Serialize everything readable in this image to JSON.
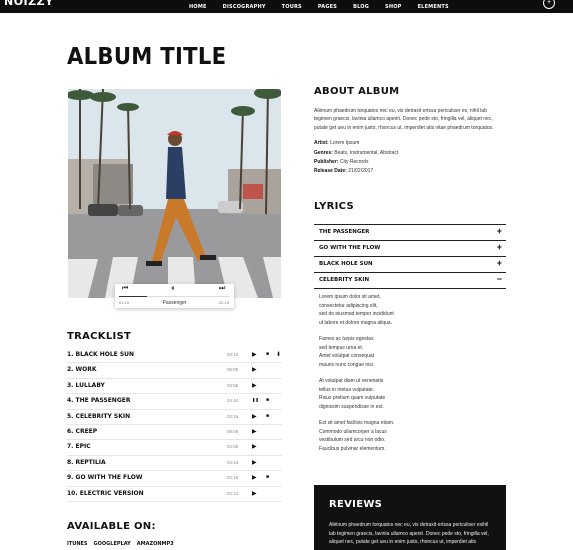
{
  "header": {
    "logo": "NOIZZY",
    "nav": [
      "HOME",
      "DISCOGRAPHY",
      "TOURS",
      "PAGES",
      "BLOG",
      "SHOP",
      "ELEMENTS"
    ],
    "menu_icon": "plus-circle-icon"
  },
  "album": {
    "title": "ALBUM TITLE"
  },
  "player": {
    "current_time": "01:15",
    "track_name": "Passenger",
    "total_time": "02:15",
    "progress": 0.25,
    "prev_icon": "skip-back-icon",
    "pause_icon": "pause-icon",
    "next_icon": "skip-forward-icon"
  },
  "tracklist": {
    "title": "TRACKLIST",
    "tracks": [
      {
        "name": "1. BLACK HOLE SUN",
        "duration": "02:16",
        "icons": [
          "play",
          "video",
          "download"
        ]
      },
      {
        "name": "2. WORK",
        "duration": "05:05",
        "icons": [
          "play"
        ]
      },
      {
        "name": "3. LULLABY",
        "duration": "02:55",
        "icons": [
          "play"
        ]
      },
      {
        "name": "4. THE PASSENGER",
        "duration": "04:44",
        "icons": [
          "pause",
          "video"
        ]
      },
      {
        "name": "5. CELEBRITY SKIN",
        "duration": "02:16",
        "icons": [
          "play",
          "video"
        ]
      },
      {
        "name": "6. CREEP",
        "duration": "05:05",
        "icons": [
          "play"
        ]
      },
      {
        "name": "7. EPIC",
        "duration": "02:55",
        "icons": [
          "play"
        ]
      },
      {
        "name": "8. REPTILIA",
        "duration": "04:44",
        "icons": [
          "play"
        ]
      },
      {
        "name": "9. GO WITH THE FLOW",
        "duration": "02:16",
        "icons": [
          "play",
          "video"
        ]
      },
      {
        "name": "10. ELECTRIC VERSION",
        "duration": "02:12",
        "icons": [
          "play"
        ]
      }
    ]
  },
  "available": {
    "title": "AVAILABLE ON:",
    "stores": [
      "ITUNES",
      "GOOGLEPLAY",
      "AMAZONMP3"
    ]
  },
  "about": {
    "title": "ABOUT ALBUM",
    "text": "Aliénum phaedrum torquatos nec eu, vis detraxit ertssa periculiser ex, nihil lab tegimen graecis, lavinia ullamco aperiri. Donec pede sto, fringilla vel, aliquet nec, putate get ueu in enim justo, rhoncus ut, imperdiet atis vitae phaedrum torquatos.",
    "artist_label": "Artist:",
    "artist": "Lorem Ipsum",
    "genres_label": "Genres:",
    "genres": "Beats, Instrumental, Abstract",
    "publisher_label": "Publisher:",
    "publisher": "City Records",
    "release_label": "Release Date:",
    "release": "21/02/2017"
  },
  "lyrics": {
    "title": "LYRICS",
    "items": [
      {
        "label": "THE PASSENGER",
        "sign": "+"
      },
      {
        "label": "GO WITH THE FLOW",
        "sign": "+"
      },
      {
        "label": "BLACK HOLE SUN",
        "sign": "+"
      },
      {
        "label": "CELEBRITY SKIN",
        "sign": "−"
      }
    ],
    "stanzas": [
      [
        "Lorem ipsum dolor sit amet,",
        "consectetur adipiscing elit,",
        "sed do eiusmod tempor incididunt",
        "ut labore et dolore magna aliqua."
      ],
      [
        "Fames ac turpis egestas",
        "sed tempus urna et.",
        "Amet volutpat consequat",
        "mauris nunc congue nisi."
      ],
      [
        "At volutpat diam ut venenatis",
        "tellus in metus vulputate.",
        "Risus pretium quam vulputate",
        "dignissim suspendisse in est."
      ],
      [
        "Est sit amet facilisis magna etiam.",
        "Commodo ullamcorper a lacus",
        "vestibulum sed arcu non odio.",
        "Faucibus pulvinar elementum."
      ]
    ]
  },
  "reviews": {
    "title": "REVIEWS",
    "text": "Aliénum phaedrum torquatos nec eu, vis detraxit ertssa periculiser exihil lab tegimen graecis, lavinia ullamco aperiri. Donec pede sto, fringilla vel, aliquet nec, putate get ueu in enim justo, rhoncus ut, imperdiet atis"
  }
}
